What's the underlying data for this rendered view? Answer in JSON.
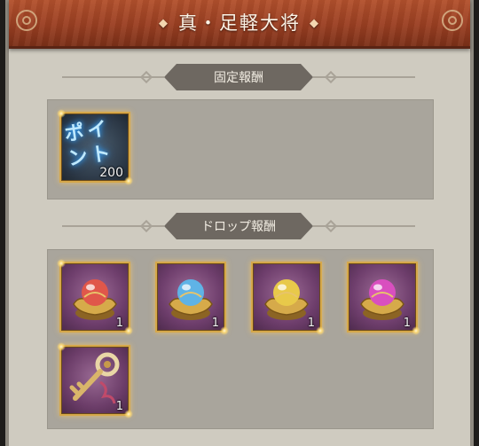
{
  "header": {
    "title": "真・足軽大将",
    "left_diamond": "◆",
    "right_diamond": "◆"
  },
  "sections": {
    "fixed": {
      "label": "固定報酬"
    },
    "drop": {
      "label": "ドロップ報酬"
    }
  },
  "fixed_rewards": [
    {
      "icon": "point-icon",
      "text": "ポイント",
      "quantity": "200"
    }
  ],
  "drop_rewards": [
    {
      "icon": "red-orb-icon",
      "orb_color": "#e0574a",
      "quantity": "1"
    },
    {
      "icon": "blue-orb-icon",
      "orb_color": "#5fb3e6",
      "quantity": "1"
    },
    {
      "icon": "yellow-orb-icon",
      "orb_color": "#e8c94a",
      "quantity": "1"
    },
    {
      "icon": "pink-orb-icon",
      "orb_color": "#d94fbf",
      "quantity": "1"
    },
    {
      "icon": "key-icon",
      "quantity": "1"
    }
  ]
}
